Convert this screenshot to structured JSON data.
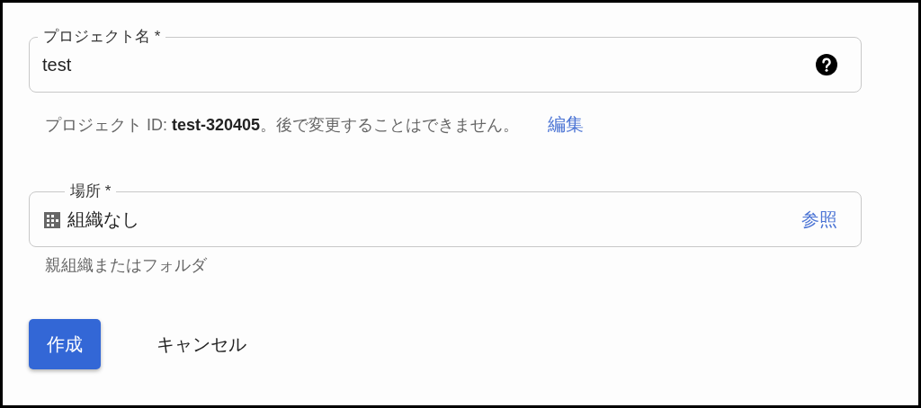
{
  "project_name": {
    "label": "プロジェクト名 *",
    "value": "test"
  },
  "project_id": {
    "text": "プロジェクト ID: **test-320405**。後で変更することはできません。",
    "edit_link": "編集"
  },
  "location": {
    "label": "場所 *",
    "value": "組織なし",
    "browse_link": "参照",
    "hint": "親組織またはフォルダ"
  },
  "buttons": [
    {
      "kind": "primary",
      "label": "作成"
    },
    {
      "kind": "text",
      "label": "キャンセル"
    }
  ]
}
